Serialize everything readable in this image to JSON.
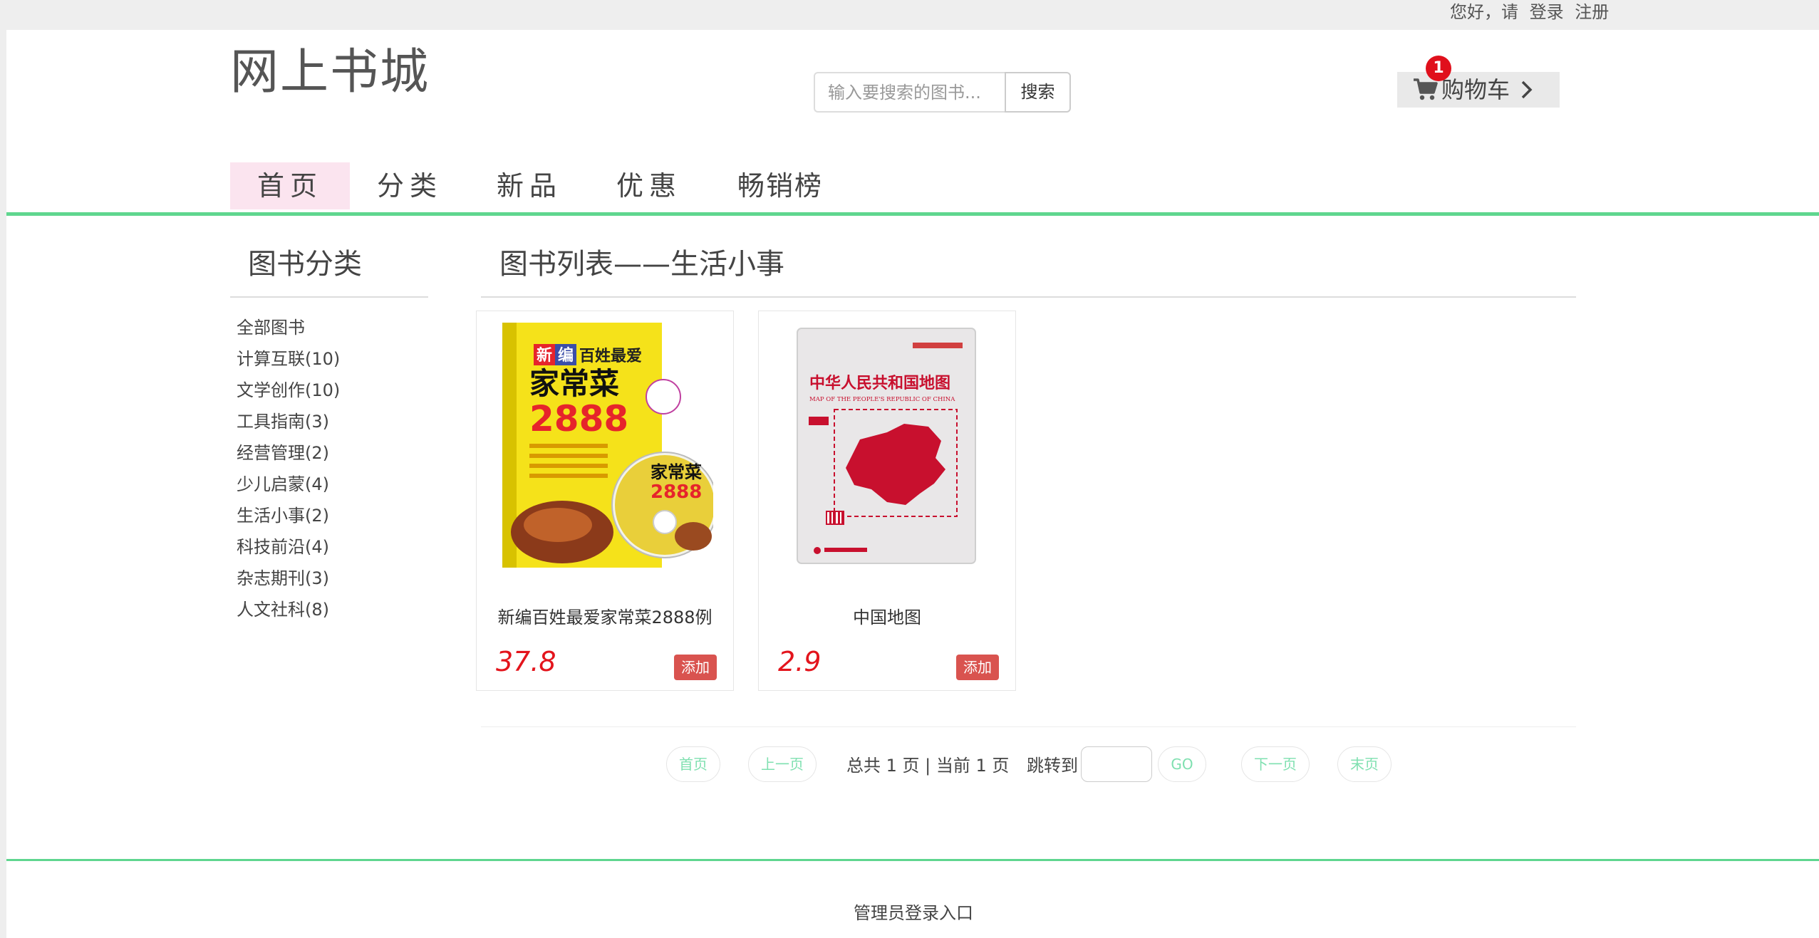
{
  "topbar": {
    "greeting": "您好，请",
    "login": "登录",
    "register": "注册"
  },
  "header": {
    "logo": "网上书城",
    "search_placeholder": "输入要搜索的图书...",
    "search_button": "搜索",
    "cart_label": "购物车",
    "cart_count": "1"
  },
  "nav": {
    "items": [
      {
        "label": "首页",
        "active": true
      },
      {
        "label": "分类"
      },
      {
        "label": "新品"
      },
      {
        "label": "优惠"
      },
      {
        "label": "畅销榜"
      }
    ]
  },
  "sidebar": {
    "title": "图书分类",
    "categories": [
      "全部图书",
      "计算互联(10)",
      "文学创作(10)",
      "工具指南(3)",
      "经营管理(2)",
      "少儿启蒙(4)",
      "生活小事(2)",
      "科技前沿(4)",
      "杂志期刊(3)",
      "人文社科(8)"
    ]
  },
  "main": {
    "title": "图书列表——生活小事",
    "books": [
      {
        "title": "新编百姓最爱家常菜2888例",
        "price": "37.8",
        "add_label": "添加",
        "cover": {
          "tag": "新",
          "tag2": "编",
          "line1": "百姓最爱",
          "line2": "家常菜",
          "line3": "2888",
          "disc_title": "家常菜",
          "disc_num": "2888"
        }
      },
      {
        "title": "中国地图",
        "price": "2.9",
        "add_label": "添加",
        "cover": {
          "cn_title": "中华人民共和国地图",
          "en_title": "MAP OF THE PEOPLE'S REPUBLIC OF CHINA"
        }
      }
    ]
  },
  "pager": {
    "first": "首页",
    "prev": "上一页",
    "summary": "总共 1 页 | 当前 1 页",
    "jump_label": "跳转到",
    "go": "GO",
    "next": "下一页",
    "last": "末页"
  },
  "footer": {
    "admin_link": "管理员登录入口"
  },
  "colors": {
    "accent_green": "#5fd68f",
    "price_red": "#e3141c",
    "add_button": "#d9534f",
    "nav_active_bg": "#fbe4ef",
    "badge_red": "#e0101c"
  }
}
